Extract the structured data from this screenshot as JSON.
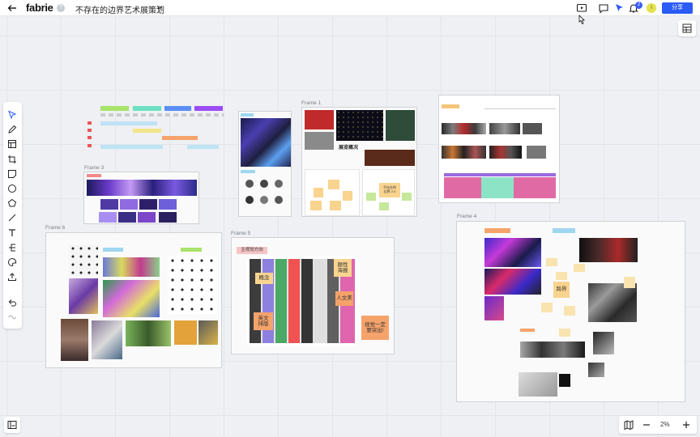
{
  "app": {
    "logo": "fabrie",
    "help": "?",
    "title": "不存在的边界艺术展策划",
    "share_label": "分享",
    "notification_count": "2",
    "avatar_initial": "i",
    "accent_color": "#2b5bf5"
  },
  "toolbar_icons": [
    "present-icon",
    "comment-icon",
    "ai-cursor-icon",
    "notification-icon"
  ],
  "tools": [
    "select-tool",
    "pen-tool",
    "frame-tool",
    "crop-tool",
    "sticky-note-tool",
    "circle-tool",
    "pentagon-tool",
    "line-tool",
    "text-tool",
    "mindmap-tool",
    "shape-tool",
    "upload-tool",
    "undo-tool",
    "redo-tool"
  ],
  "zoom": {
    "level": "2%"
  },
  "frames": {
    "frame1": "Frame 1",
    "frame3": "Frame 3",
    "frame4": "Frame 4",
    "frame5": "Frame 5",
    "frame6": "Frame 6"
  },
  "frame5_notes": {
    "header": "主视觉方向",
    "concept": "概念",
    "humanities": "人文美",
    "twist": "颠性\n海报",
    "english": "英文\n排版",
    "visual": "视觉一定\n要突出!"
  },
  "frame4_notes": {
    "center": "跨界"
  },
  "frame1_notes": {
    "title": "展览概况",
    "boundary": "不存在的\n边界 2.0"
  }
}
